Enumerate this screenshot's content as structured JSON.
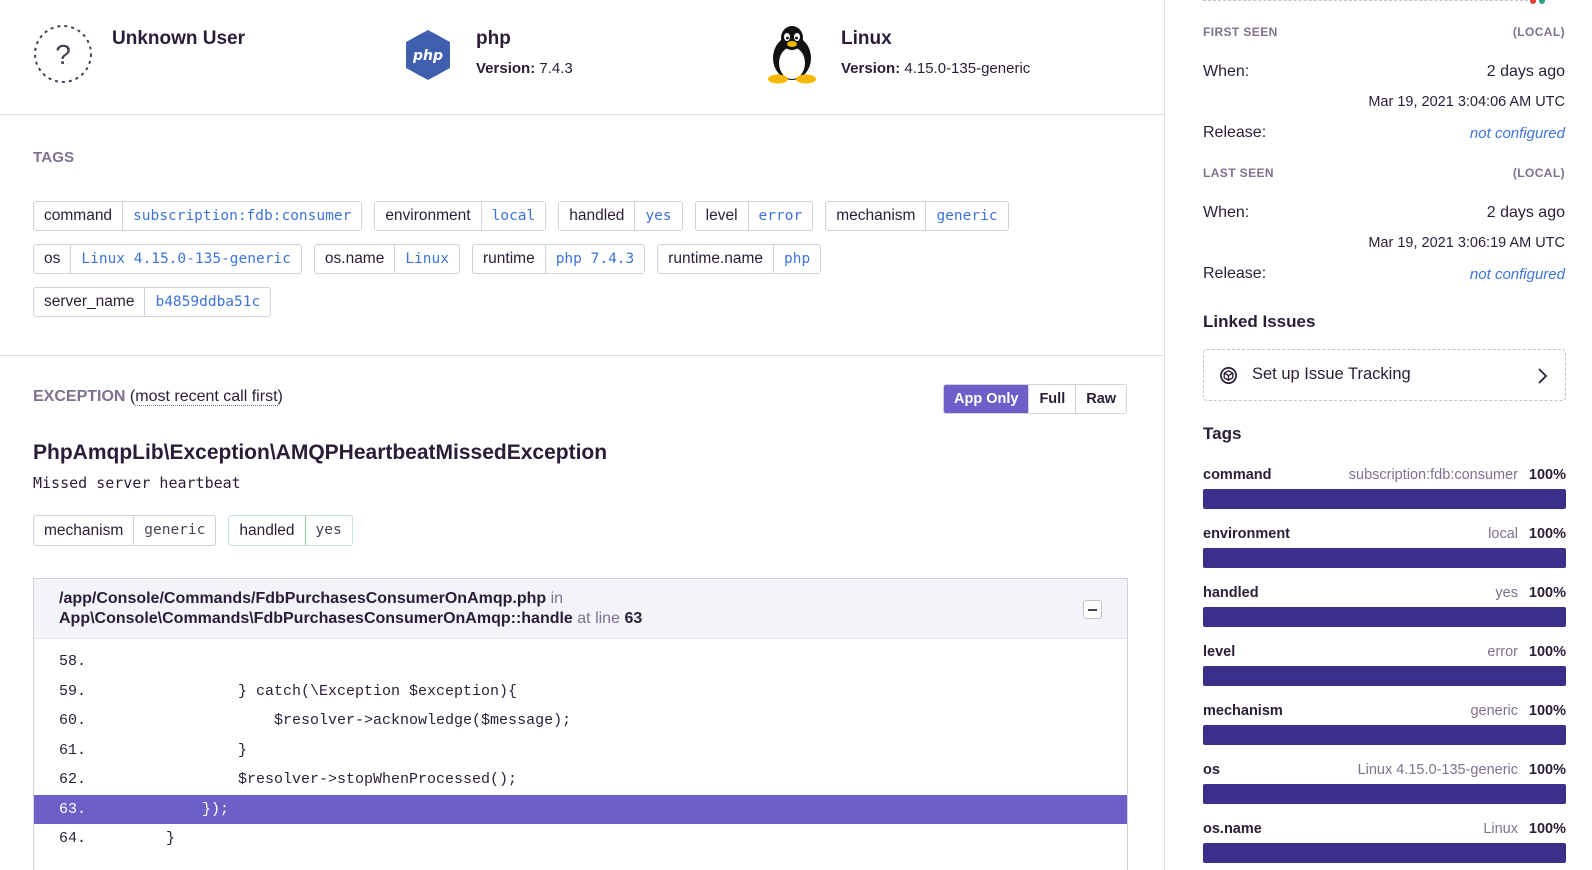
{
  "context": {
    "user": {
      "title": "Unknown User",
      "icon": "unknown-user-icon"
    },
    "runtime": {
      "title": "php",
      "version_label": "Version:",
      "version": "7.4.3",
      "icon": "php-icon"
    },
    "os": {
      "title": "Linux",
      "version_label": "Version:",
      "version": "4.15.0-135-generic",
      "icon": "tux-icon"
    }
  },
  "tags_section": {
    "title": "TAGS",
    "rows": [
      [
        {
          "key": "command",
          "value": "subscription:fdb:consumer"
        },
        {
          "key": "environment",
          "value": "local"
        },
        {
          "key": "handled",
          "value": "yes"
        },
        {
          "key": "level",
          "value": "error"
        },
        {
          "key": "mechanism",
          "value": "generic"
        }
      ],
      [
        {
          "key": "os",
          "value": "Linux 4.15.0-135-generic"
        },
        {
          "key": "os.name",
          "value": "Linux"
        },
        {
          "key": "runtime",
          "value": "php 7.4.3"
        },
        {
          "key": "runtime.name",
          "value": "php"
        }
      ],
      [
        {
          "key": "server_name",
          "value": "b4859ddba51c"
        }
      ]
    ]
  },
  "exception": {
    "label": "EXCEPTION",
    "paren_open": " (",
    "subtitle": "most recent call first",
    "paren_close": ")",
    "view_buttons": [
      {
        "label": "App Only",
        "active": true
      },
      {
        "label": "Full",
        "active": false
      },
      {
        "label": "Raw",
        "active": false
      }
    ],
    "type": "PhpAmqpLib\\Exception\\AMQPHeartbeatMissedException",
    "message": "Missed server heartbeat",
    "mechanism": {
      "key": "mechanism",
      "value": "generic"
    },
    "handled": {
      "key": "handled",
      "value": "yes"
    },
    "frame": {
      "file": "/app/Console/Commands/FdbPurchasesConsumerOnAmqp.php",
      "in_label": "in",
      "function": "App\\Console\\Commands\\FdbPurchasesConsumerOnAmqp::handle",
      "at_line_label": "at line",
      "line": "63",
      "lines": [
        {
          "no": "58.",
          "code": "",
          "active": false
        },
        {
          "no": "59.",
          "code": "            } catch(\\Exception $exception){",
          "active": false
        },
        {
          "no": "60.",
          "code": "                $resolver->acknowledge($message);",
          "active": false
        },
        {
          "no": "61.",
          "code": "            }",
          "active": false
        },
        {
          "no": "62.",
          "code": "            $resolver->stopWhenProcessed();",
          "active": false
        },
        {
          "no": "63.",
          "code": "        });",
          "active": true
        },
        {
          "no": "64.",
          "code": "    }",
          "active": false
        }
      ]
    }
  },
  "sidebar": {
    "first_seen": {
      "label": "FIRST SEEN",
      "tz": "(LOCAL)",
      "when_label": "When:",
      "when": "2 days ago",
      "timestamp": "Mar 19, 2021 3:04:06 AM UTC",
      "release_label": "Release:",
      "release": "not configured"
    },
    "last_seen": {
      "label": "LAST SEEN",
      "tz": "(LOCAL)",
      "when_label": "When:",
      "when": "2 days ago",
      "timestamp": "Mar 19, 2021 3:06:19 AM UTC",
      "release_label": "Release:",
      "release": "not configured"
    },
    "linked_issues": {
      "title": "Linked Issues",
      "setup_label": "Set up Issue Tracking"
    },
    "tags": {
      "title": "Tags",
      "items": [
        {
          "key": "command",
          "value": "subscription:fdb:consumer",
          "percent": "100%",
          "fraction": 1.0
        },
        {
          "key": "environment",
          "value": "local",
          "percent": "100%",
          "fraction": 1.0
        },
        {
          "key": "handled",
          "value": "yes",
          "percent": "100%",
          "fraction": 1.0
        },
        {
          "key": "level",
          "value": "error",
          "percent": "100%",
          "fraction": 1.0
        },
        {
          "key": "mechanism",
          "value": "generic",
          "percent": "100%",
          "fraction": 1.0
        },
        {
          "key": "os",
          "value": "Linux 4.15.0-135-generic",
          "percent": "100%",
          "fraction": 1.0
        },
        {
          "key": "os.name",
          "value": "Linux",
          "percent": "100%",
          "fraction": 1.0
        }
      ]
    }
  },
  "colors": {
    "accent": "#6c5fc7",
    "bar": "#3b2f8c",
    "link": "#3d74db"
  }
}
